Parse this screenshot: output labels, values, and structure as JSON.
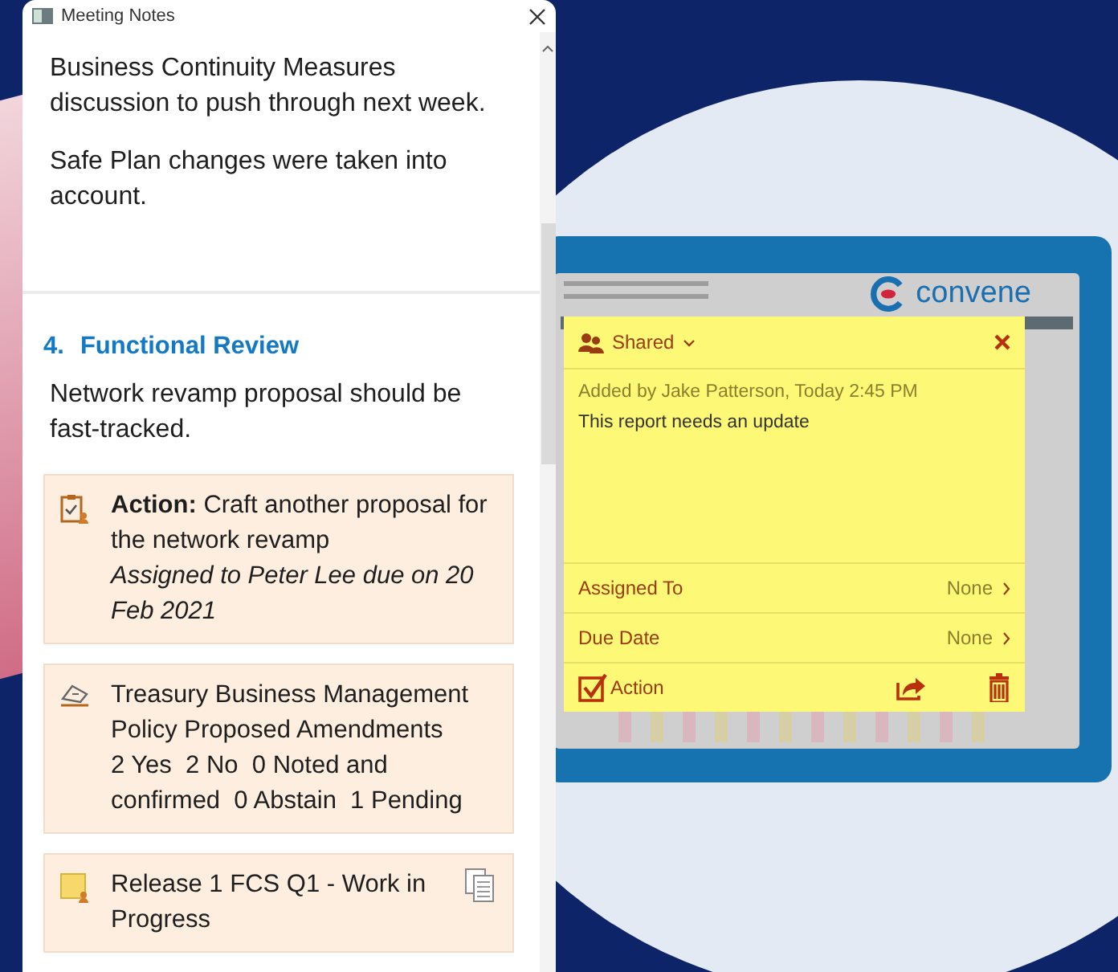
{
  "window": {
    "title": "Meeting Notes"
  },
  "notes": {
    "paragraphs": [
      "Business Continuity Measures discussion to push through next week.",
      "Safe Plan changes were taken into account."
    ],
    "section": {
      "number": "4.",
      "title": "Functional Review",
      "text": "Network revamp proposal should be fast-tracked."
    },
    "cards": [
      {
        "kind": "action",
        "text": "**Action:** Craft another proposal for the network revamp",
        "assignment": "Assigned to Peter Lee due on 20 Feb 2021"
      },
      {
        "kind": "vote",
        "title": "Treasury Business Management Policy Proposed Amendments",
        "tallies": "2 Yes  2 No  0 Noted and confirmed  0 Abstain  1 Pending"
      },
      {
        "kind": "note",
        "text": "Release 1 FCS Q1 - Work in Progress"
      }
    ]
  },
  "tablet": {
    "logo": "convene",
    "sticky_note": {
      "visibility": "Shared",
      "author_line": "Added by Jake Patterson, Today 2:45 PM",
      "text": "This report needs an update",
      "fields": [
        {
          "label": "Assigned To",
          "value": "None"
        },
        {
          "label": "Due Date",
          "value": "None"
        }
      ],
      "action": {
        "label": "Action",
        "checked": true
      }
    }
  }
}
